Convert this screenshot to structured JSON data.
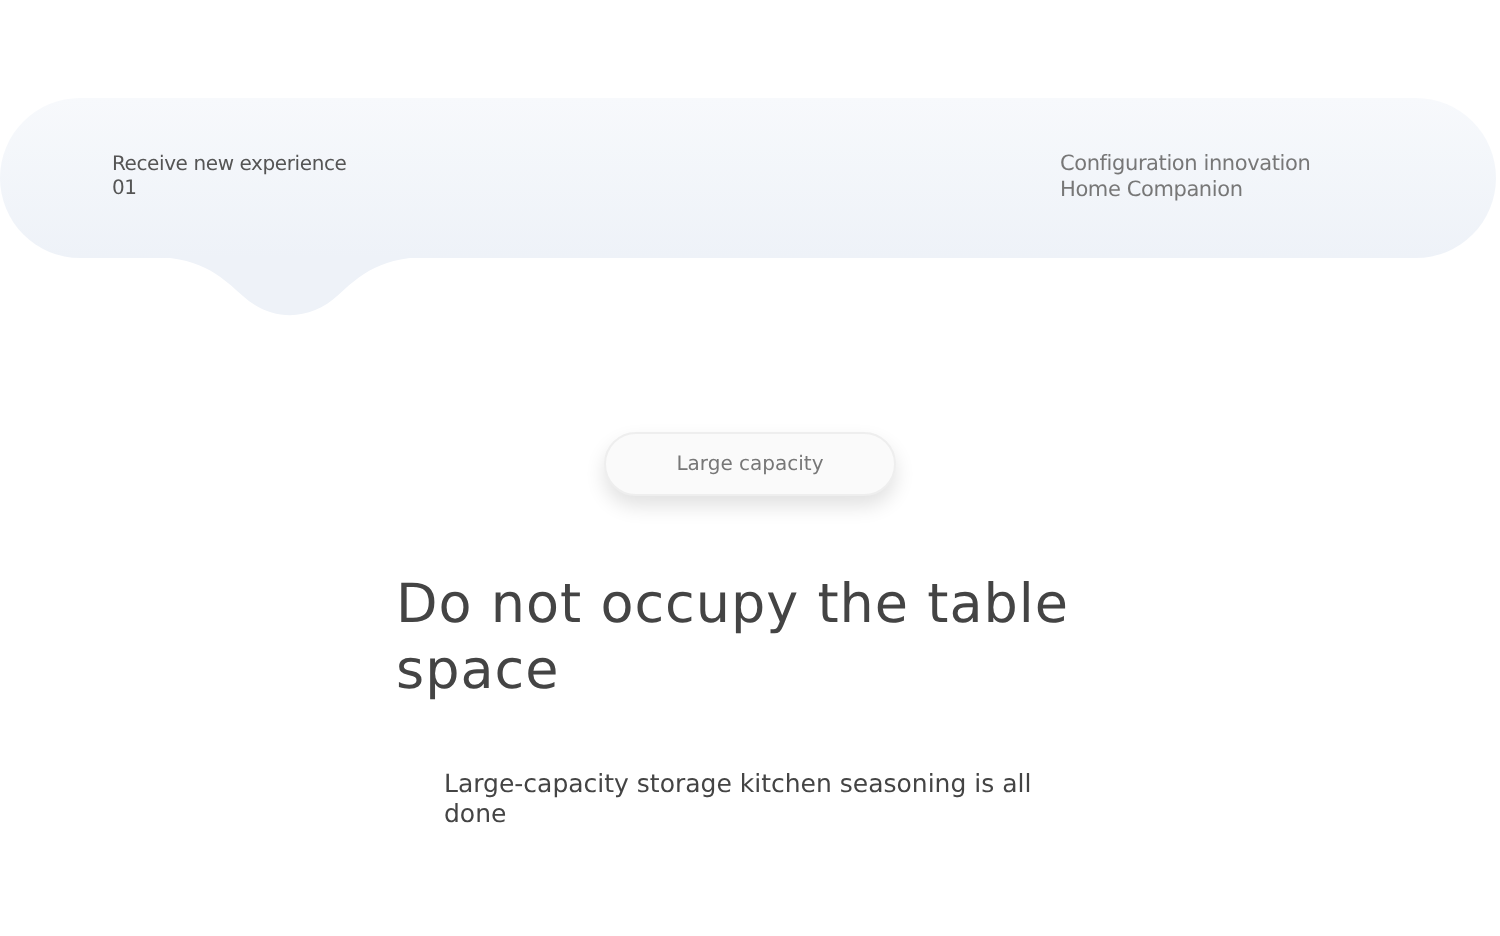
{
  "tabs": [
    {
      "label": "Receive new experience\n01",
      "selected": true
    },
    {
      "label": "Configuration innovation\nHome Companion",
      "selected": false
    }
  ],
  "badge": "Large capacity",
  "heading": "Do not occupy the table space",
  "description": "Large-capacity storage kitchen seasoning is all done"
}
